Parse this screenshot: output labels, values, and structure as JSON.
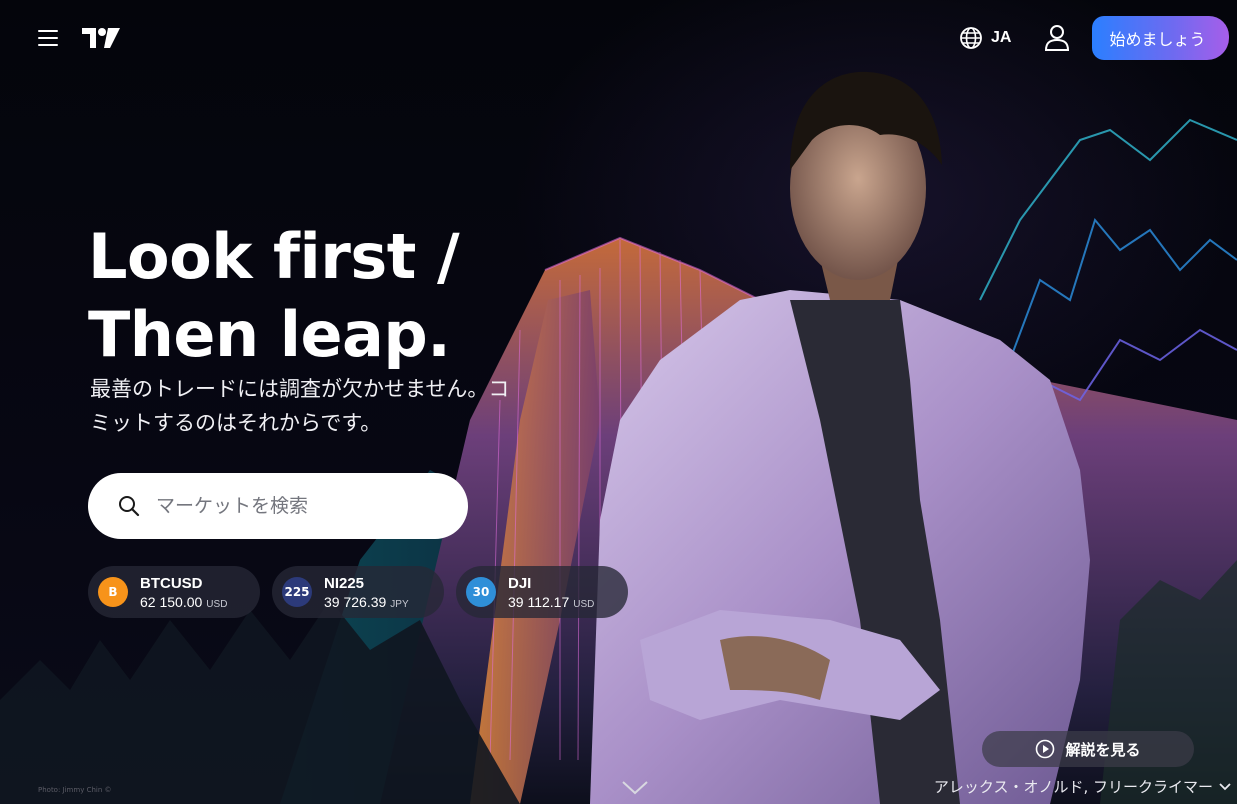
{
  "header": {
    "language_label": "JA",
    "cta_label": "始めましょう"
  },
  "hero": {
    "headline_line1": "Look first /",
    "headline_line2": "Then leap.",
    "subtitle": "最善のトレードには調査が欠かせません。コミットするのはそれからです。",
    "search_placeholder": "マーケットを検索"
  },
  "tickers": [
    {
      "badge": "B",
      "symbol": "BTCUSD",
      "price": "62 150.00",
      "currency": "USD",
      "badge_color": "#f7931a"
    },
    {
      "badge": "225",
      "symbol": "NI225",
      "price": "39 726.39",
      "currency": "JPY",
      "badge_color": "#2c3a7a"
    },
    {
      "badge": "30",
      "symbol": "DJI",
      "price": "39 112.17",
      "currency": "USD",
      "badge_color": "#2f8fd8"
    }
  ],
  "footer": {
    "watch_label": "解説を見る",
    "caption": "アレックス・オノルド, フリークライマー",
    "photo_credit": "Photo: Jimmy Chin ©"
  },
  "colors": {
    "cta_gradient_start": "#2b7fff",
    "cta_gradient_end": "#a75ee9",
    "background": "#05060c"
  },
  "icons": [
    "menu-icon",
    "tradingview-logo",
    "globe-icon",
    "user-icon",
    "search-icon",
    "play-icon",
    "chevron-down-icon"
  ]
}
